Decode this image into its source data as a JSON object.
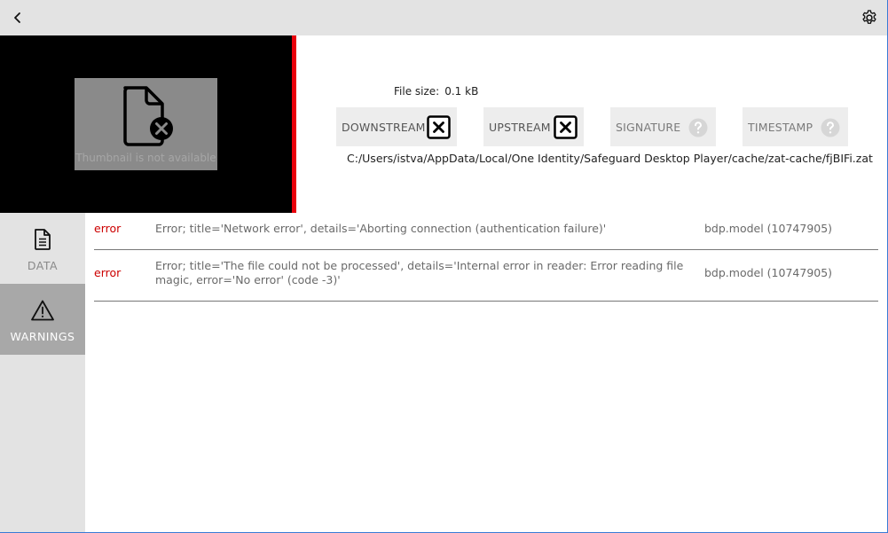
{
  "topbar": {
    "back_icon": "chevron-left-icon",
    "settings_icon": "gear-icon"
  },
  "thumbnail": {
    "placeholder_text": "Thumbnail is not available",
    "icon": "file-error-icon",
    "accent_color": "#e8000b"
  },
  "fileinfo": {
    "size_label": "File size:",
    "size_value": "0.1 kB",
    "checks": [
      {
        "label": "DOWNSTREAM",
        "status": "failed",
        "icon": "x-box-icon"
      },
      {
        "label": "UPSTREAM",
        "status": "failed",
        "icon": "x-box-icon"
      },
      {
        "label": "SIGNATURE",
        "status": "unknown",
        "icon": "question-circle-icon"
      },
      {
        "label": "TIMESTAMP",
        "status": "unknown",
        "icon": "question-circle-icon"
      }
    ],
    "path": "C:/Users/istva/AppData/Local/One Identity/Safeguard Desktop Player/cache/zat-cache/fjBIFi.zat"
  },
  "sidebar": {
    "items": [
      {
        "label": "DATA",
        "icon": "document-icon",
        "active": false
      },
      {
        "label": "WARNINGS",
        "icon": "warning-triangle-icon",
        "active": true
      }
    ]
  },
  "warnings": {
    "rows": [
      {
        "level": "error",
        "message": "Error; title='Network error', details='Aborting connection (authentication failure)'",
        "source": "bdp.model (10747905)"
      },
      {
        "level": "error",
        "message": "Error; title='The file could not be processed', details='Internal error in reader: Error reading file magic, error='No error' (code -3)'",
        "source": "bdp.model (10747905)"
      }
    ]
  },
  "colors": {
    "error_text": "#cc0000",
    "topbar_bg": "#e3e3e3",
    "sidebar_active_bg": "#a8a8a8"
  }
}
